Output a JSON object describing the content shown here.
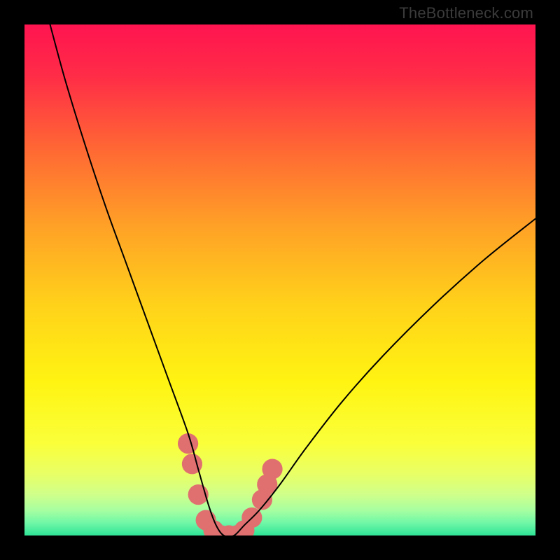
{
  "watermark": "TheBottleneck.com",
  "chart_data": {
    "type": "line",
    "title": "",
    "xlabel": "",
    "ylabel": "",
    "xlim": [
      0,
      100
    ],
    "ylim": [
      0,
      100
    ],
    "grid": false,
    "legend": false,
    "background_gradient_stops": [
      {
        "offset": 0.0,
        "color": "#ff1450"
      },
      {
        "offset": 0.1,
        "color": "#ff2c47"
      },
      {
        "offset": 0.25,
        "color": "#ff6a33"
      },
      {
        "offset": 0.4,
        "color": "#ffa326"
      },
      {
        "offset": 0.55,
        "color": "#ffd21a"
      },
      {
        "offset": 0.7,
        "color": "#fff412"
      },
      {
        "offset": 0.82,
        "color": "#faff3a"
      },
      {
        "offset": 0.88,
        "color": "#e8ff66"
      },
      {
        "offset": 0.92,
        "color": "#cfff8a"
      },
      {
        "offset": 0.95,
        "color": "#a8ffa0"
      },
      {
        "offset": 0.975,
        "color": "#70f7a6"
      },
      {
        "offset": 1.0,
        "color": "#2fe597"
      }
    ],
    "series": [
      {
        "name": "bottleneck-curve",
        "color": "#000000",
        "x": [
          5,
          8,
          12,
          16,
          20,
          24,
          28,
          32,
          34,
          36,
          37.5,
          39,
          41,
          43,
          46,
          50,
          55,
          62,
          70,
          80,
          90,
          100
        ],
        "y": [
          100,
          89,
          76,
          64,
          53,
          42,
          31,
          20,
          13,
          6,
          2,
          0,
          0,
          2,
          5,
          10,
          17,
          26,
          35,
          45,
          54,
          62
        ]
      }
    ],
    "marker_cluster": {
      "name": "bottom-markers",
      "color": "#e07070",
      "points": [
        {
          "x": 32.0,
          "y": 18
        },
        {
          "x": 32.8,
          "y": 14
        },
        {
          "x": 34.0,
          "y": 8
        },
        {
          "x": 35.5,
          "y": 3
        },
        {
          "x": 37.0,
          "y": 1
        },
        {
          "x": 38.5,
          "y": 0
        },
        {
          "x": 40.0,
          "y": 0
        },
        {
          "x": 41.5,
          "y": 0
        },
        {
          "x": 43.0,
          "y": 1
        },
        {
          "x": 44.5,
          "y": 3.5
        },
        {
          "x": 46.5,
          "y": 7
        },
        {
          "x": 47.5,
          "y": 10
        },
        {
          "x": 48.5,
          "y": 13
        }
      ],
      "radius_data_units": 2.0
    }
  }
}
